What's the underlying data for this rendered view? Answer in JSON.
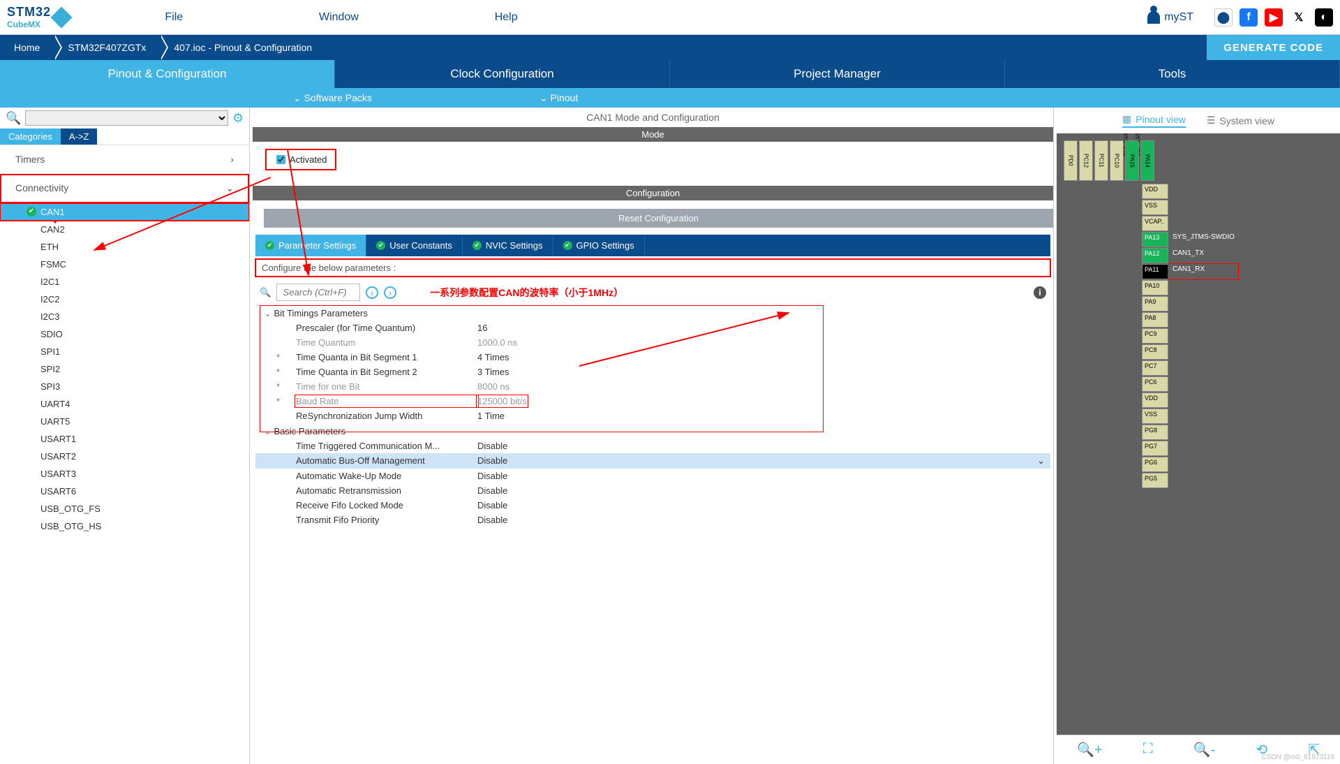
{
  "menu": {
    "file": "File",
    "window": "Window",
    "help": "Help",
    "myst": "myST"
  },
  "breadcrumbs": [
    "Home",
    "STM32F407ZGTx",
    "407.ioc - Pinout & Configuration"
  ],
  "generate": "GENERATE CODE",
  "main_tabs": [
    "Pinout & Configuration",
    "Clock Configuration",
    "Project Manager",
    "Tools"
  ],
  "subbar": [
    "Software Packs",
    "Pinout"
  ],
  "cat_tabs": [
    "Categories",
    "A->Z"
  ],
  "groups": {
    "timers": "Timers",
    "connectivity": "Connectivity"
  },
  "conn_items": [
    "CAN1",
    "CAN2",
    "ETH",
    "FSMC",
    "I2C1",
    "I2C2",
    "I2C3",
    "SDIO",
    "SPI1",
    "SPI2",
    "SPI3",
    "UART4",
    "UART5",
    "USART1",
    "USART2",
    "USART3",
    "USART6",
    "USB_OTG_FS",
    "USB_OTG_HS"
  ],
  "center_title": "CAN1 Mode and Configuration",
  "mode_label": "Mode",
  "activated": "Activated",
  "conf_label": "Configuration",
  "reset": "Reset Configuration",
  "ptabs": [
    "Parameter Settings",
    "User Constants",
    "NVIC Settings",
    "GPIO Settings"
  ],
  "conf_hint": "Configure the below parameters :",
  "search_ph": "Search (Ctrl+F)",
  "annotation": "一系列参数配置CAN的波特率（小于1MHz）",
  "bit_group": "Bit Timings Parameters",
  "bit_rows": [
    {
      "k": "Prescaler (for Time Quantum)",
      "v": "16",
      "s": 0,
      "g": 0
    },
    {
      "k": "Time Quantum",
      "v": "1000.0 ns",
      "s": 0,
      "g": 1
    },
    {
      "k": "Time Quanta in Bit Segment 1",
      "v": "4 Times",
      "s": 1,
      "g": 0
    },
    {
      "k": "Time Quanta in Bit Segment 2",
      "v": "3 Times",
      "s": 1,
      "g": 0
    },
    {
      "k": "Time for one Bit",
      "v": "8000 ns",
      "s": 1,
      "g": 1
    },
    {
      "k": "Baud Rate",
      "v": "125000 bit/s",
      "s": 1,
      "g": 1,
      "hl": 1
    },
    {
      "k": "ReSynchronization Jump Width",
      "v": "1 Time",
      "s": 0,
      "g": 0
    }
  ],
  "basic_group": "Basic Parameters",
  "basic_rows": [
    {
      "k": "Time Triggered Communication M...",
      "v": "Disable"
    },
    {
      "k": "Automatic Bus-Off Management",
      "v": "Disable",
      "sel": 1
    },
    {
      "k": "Automatic Wake-Up Mode",
      "v": "Disable"
    },
    {
      "k": "Automatic Retransmission",
      "v": "Disable"
    },
    {
      "k": "Receive Fifo Locked Mode",
      "v": "Disable"
    },
    {
      "k": "Transmit Fifo Priority",
      "v": "Disable"
    }
  ],
  "view_tabs": {
    "pinout": "Pinout view",
    "system": "System view"
  },
  "top_pins_v": [
    "SYS_JTD",
    "SYS_JTC"
  ],
  "top_pins": [
    "PD0",
    "PC12",
    "PC11",
    "PC10",
    "PA15",
    "PA14"
  ],
  "side_pins": [
    {
      "n": "VDD",
      "c": "y"
    },
    {
      "n": "VSS",
      "c": "y"
    },
    {
      "n": "VCAP..",
      "c": "y"
    },
    {
      "n": "PA13",
      "c": "g",
      "lbl": "SYS_JTMS-SWDIO"
    },
    {
      "n": "PA12",
      "c": "g",
      "lbl": "CAN1_TX"
    },
    {
      "n": "PA11",
      "c": "b",
      "lbl": "CAN1_RX",
      "boxed": 1
    },
    {
      "n": "PA10",
      "c": "y"
    },
    {
      "n": "PA9",
      "c": "y"
    },
    {
      "n": "PA8",
      "c": "y"
    },
    {
      "n": "PC9",
      "c": "y"
    },
    {
      "n": "PC8",
      "c": "y"
    },
    {
      "n": "PC7",
      "c": "y"
    },
    {
      "n": "PC6",
      "c": "y"
    },
    {
      "n": "VDD",
      "c": "y"
    },
    {
      "n": "VSS",
      "c": "y"
    },
    {
      "n": "PG8",
      "c": "y"
    },
    {
      "n": "PG7",
      "c": "y"
    },
    {
      "n": "PG6",
      "c": "y"
    },
    {
      "n": "PG5",
      "c": "y"
    }
  ],
  "watermark": "CSDN @m0_61973119"
}
